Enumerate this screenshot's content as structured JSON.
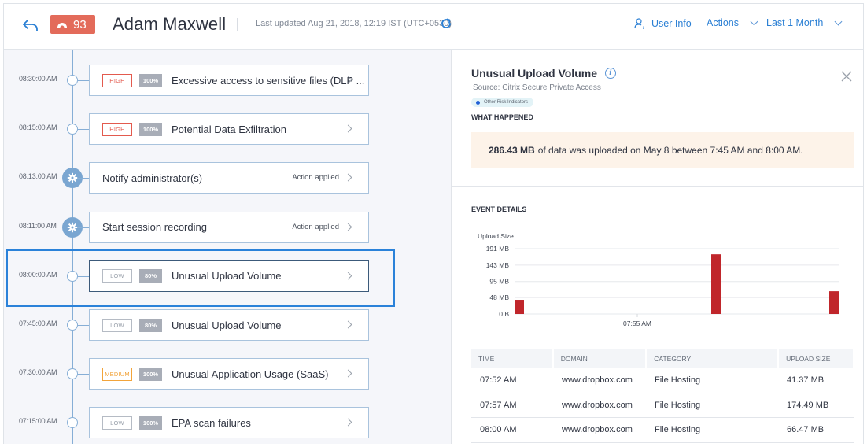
{
  "header": {
    "risk_score": "93",
    "user_name": "Adam Maxwell",
    "last_updated": "Last updated Aug 21, 2018, 12:19 IST (UTC+0530)",
    "user_info_label": "User Info",
    "actions_label": "Actions",
    "range_label": "Last 1 Month",
    "colors": {
      "accent": "#2a7fd4",
      "score_badge": "#e36b5a"
    }
  },
  "timeline": {
    "selected_index": 4,
    "items": [
      {
        "time": "08:30:00 AM",
        "kind": "indicator",
        "severity": "HIGH",
        "severity_level": "high",
        "confidence": "100%",
        "title": "Excessive access to sensitive files (DLP ..."
      },
      {
        "time": "08:15:00 AM",
        "kind": "indicator",
        "severity": "HIGH",
        "severity_level": "high",
        "confidence": "100%",
        "title": "Potential Data Exfiltration"
      },
      {
        "time": "08:13:00 AM",
        "kind": "action",
        "title": "Notify administrator(s)",
        "status": "Action applied"
      },
      {
        "time": "08:11:00 AM",
        "kind": "action",
        "title": "Start session recording",
        "status": "Action applied"
      },
      {
        "time": "08:00:00 AM",
        "kind": "indicator",
        "severity": "LOW",
        "severity_level": "low",
        "confidence": "80%",
        "title": "Unusual Upload Volume"
      },
      {
        "time": "07:45:00 AM",
        "kind": "indicator",
        "severity": "LOW",
        "severity_level": "low",
        "confidence": "80%",
        "title": "Unusual Upload Volume"
      },
      {
        "time": "07:30:00 AM",
        "kind": "indicator",
        "severity": "MEDIUM",
        "severity_level": "medium",
        "confidence": "100%",
        "title": "Unusual Application Usage (SaaS)"
      },
      {
        "time": "07:15:00 AM",
        "kind": "indicator",
        "severity": "LOW",
        "severity_level": "low",
        "confidence": "100%",
        "title": "EPA scan failures"
      }
    ]
  },
  "detail": {
    "title": "Unusual Upload Volume",
    "source": "Source: Citrix Secure Private Access",
    "tag": "Other Risk Indicators",
    "what_happened_label": "WHAT HAPPENED",
    "summary_bold": "286.43 MB",
    "summary_rest": "of data was uploaded on May 8 between 7:45 AM and 8:00 AM.",
    "event_details_label": "EVENT DETAILS",
    "table": {
      "columns": [
        "TIME",
        "DOMAIN",
        "CATEGORY",
        "UPLOAD SIZE"
      ],
      "rows": [
        [
          "07:52 AM",
          "www.dropbox.com",
          "File Hosting",
          "41.37 MB"
        ],
        [
          "07:57 AM",
          "www.dropbox.com",
          "File Hosting",
          "174.49 MB"
        ],
        [
          "08:00 AM",
          "www.dropbox.com",
          "File Hosting",
          "66.47 MB"
        ]
      ]
    }
  },
  "chart_data": {
    "type": "bar",
    "title": "",
    "ylabel": "Upload Size",
    "xlabel": "",
    "yticks": [
      "0 B",
      "48 MB",
      "95 MB",
      "143 MB",
      "191 MB"
    ],
    "ytick_values": [
      0,
      48,
      95,
      143,
      191
    ],
    "ylim": [
      0,
      191
    ],
    "xticks": [
      {
        "label": "07:55 AM",
        "minute": 55
      }
    ],
    "xlim_minutes": [
      52,
      60
    ],
    "points": [
      {
        "time": "07:52 AM",
        "minute": 52,
        "value": 41.37
      },
      {
        "time": "07:57 AM",
        "minute": 57,
        "value": 174.49
      },
      {
        "time": "08:00 AM",
        "minute": 60,
        "value": 66.47
      }
    ],
    "bar_color": "#c0262b",
    "grid": true
  }
}
